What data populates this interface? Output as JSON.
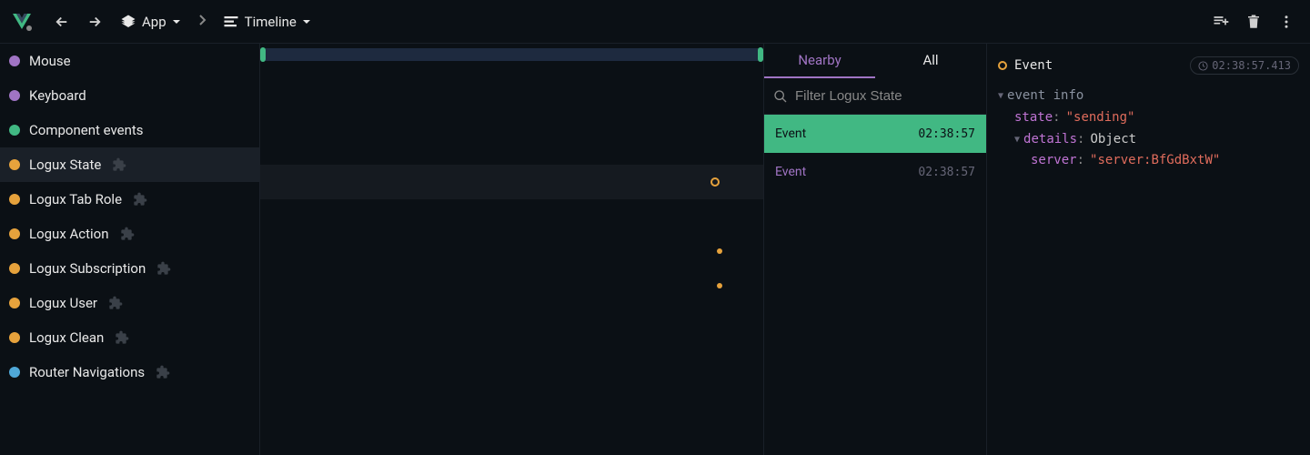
{
  "toolbar": {
    "app_label": "App",
    "view_label": "Timeline"
  },
  "sidebar": {
    "items": [
      {
        "label": "Mouse",
        "color": "#a074c4",
        "plugin": false
      },
      {
        "label": "Keyboard",
        "color": "#a074c4",
        "plugin": false
      },
      {
        "label": "Component events",
        "color": "#41b883",
        "plugin": false
      },
      {
        "label": "Logux State",
        "color": "#e6a23c",
        "plugin": true,
        "active": true
      },
      {
        "label": "Logux Tab Role",
        "color": "#e6a23c",
        "plugin": true
      },
      {
        "label": "Logux Action",
        "color": "#e6a23c",
        "plugin": true
      },
      {
        "label": "Logux Subscription",
        "color": "#e6a23c",
        "plugin": true
      },
      {
        "label": "Logux User",
        "color": "#e6a23c",
        "plugin": true
      },
      {
        "label": "Logux Clean",
        "color": "#e6a23c",
        "plugin": true
      },
      {
        "label": "Router Navigations",
        "color": "#4fa8d8",
        "plugin": true
      }
    ]
  },
  "events": {
    "tabs": {
      "nearby": "Nearby",
      "all": "All"
    },
    "filter_placeholder": "Filter Logux State",
    "list": [
      {
        "label": "Event",
        "time": "02:38:57",
        "selected": true
      },
      {
        "label": "Event",
        "time": "02:38:57",
        "purple": true
      }
    ]
  },
  "inspector": {
    "title": "Event",
    "timestamp": "02:38:57.413",
    "section": "event info",
    "state_key": "state",
    "state_value": "\"sending\"",
    "details_key": "details",
    "details_type": "Object",
    "server_key": "server",
    "server_value": "\"server:BfGdBxtW\""
  }
}
